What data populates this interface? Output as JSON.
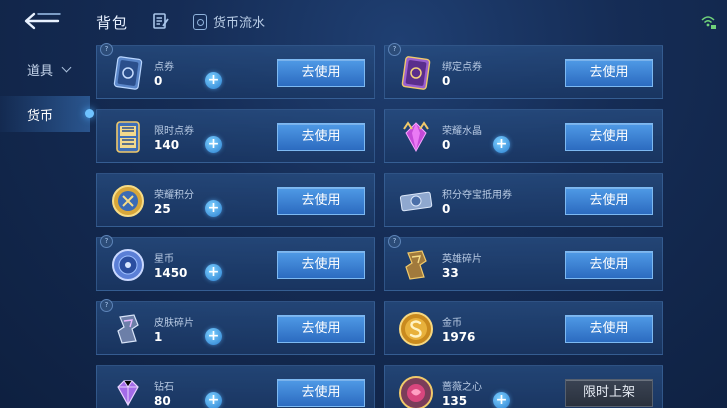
{
  "header": {
    "title": "背包",
    "flow_label": "货币流水"
  },
  "sidebar": {
    "items": [
      {
        "label": "道具"
      },
      {
        "label": "货币"
      }
    ]
  },
  "cards": [
    {
      "name": "点券",
      "count": "0",
      "button": "去使用",
      "icon": "ticket-card-icon"
    },
    {
      "name": "绑定点券",
      "count": "0",
      "button": "去使用",
      "icon": "bound-ticket-card-icon"
    },
    {
      "name": "限时点券",
      "count": "140",
      "button": "去使用",
      "icon": "limited-ticket-icon"
    },
    {
      "name": "荣耀水晶",
      "count": "0",
      "button": "去使用",
      "icon": "glory-crystal-icon"
    },
    {
      "name": "荣耀积分",
      "count": "25",
      "button": "去使用",
      "icon": "glory-points-coin-icon"
    },
    {
      "name": "积分夺宝抵用券",
      "count": "0",
      "button": "去使用",
      "icon": "treasure-voucher-icon"
    },
    {
      "name": "星币",
      "count": "1450",
      "button": "去使用",
      "icon": "star-coin-icon"
    },
    {
      "name": "英雄碎片",
      "count": "33",
      "button": "去使用",
      "icon": "hero-fragment-icon"
    },
    {
      "name": "皮肤碎片",
      "count": "1",
      "button": "去使用",
      "icon": "skin-fragment-icon"
    },
    {
      "name": "金币",
      "count": "1976",
      "button": "去使用",
      "icon": "gold-coin-icon"
    },
    {
      "name": "钻石",
      "count": "80",
      "button": "去使用",
      "icon": "diamond-icon"
    },
    {
      "name": "蔷薇之心",
      "count": "135",
      "button": "限时上架",
      "icon": "rose-heart-icon"
    }
  ]
}
